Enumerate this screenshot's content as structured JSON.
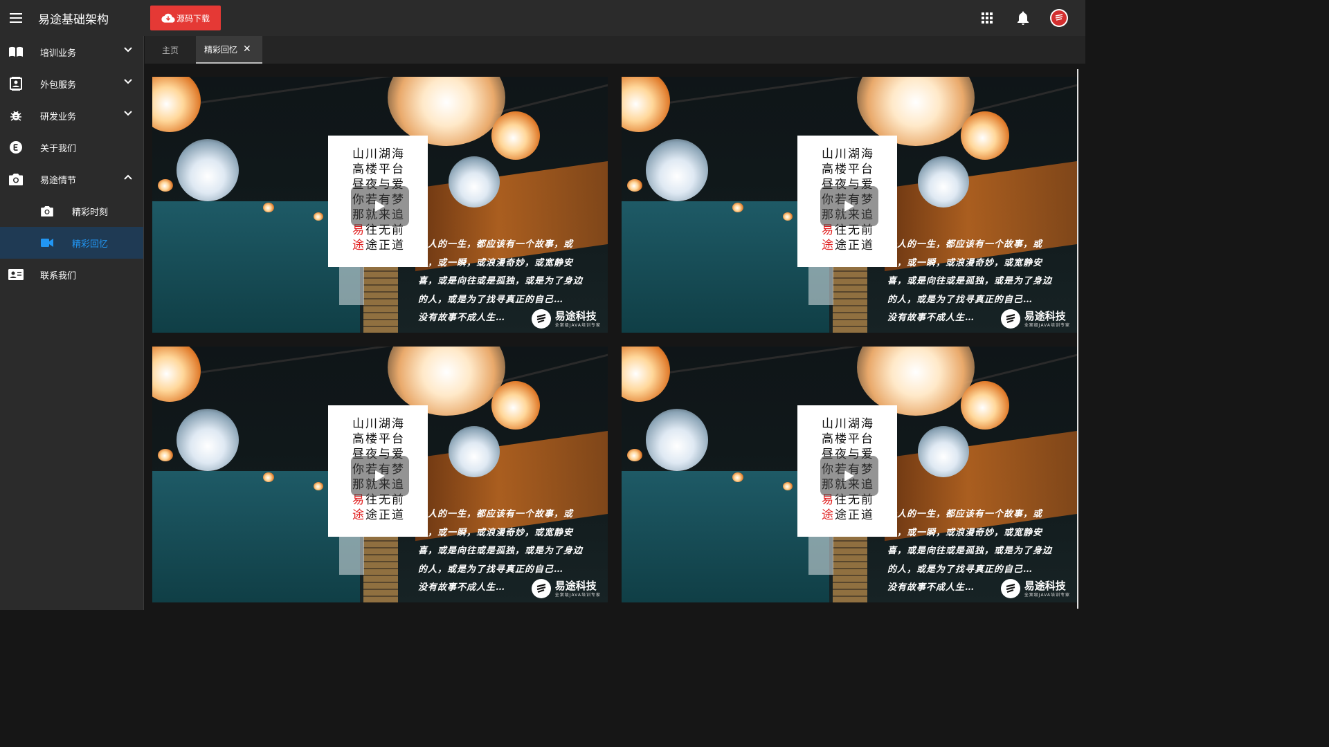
{
  "app": {
    "title": "易途基础架构",
    "download_label": "源码下载"
  },
  "top_icons": [
    "apps-grid-icon",
    "bell-icon",
    "avatar-logo"
  ],
  "sidebar": {
    "items": [
      {
        "label": "培训业务",
        "icon": "book-open-icon",
        "expandable": true,
        "expanded": false
      },
      {
        "label": "外包服务",
        "icon": "contacts-icon",
        "expandable": true,
        "expanded": false
      },
      {
        "label": "研发业务",
        "icon": "bug-icon",
        "expandable": true,
        "expanded": false
      },
      {
        "label": "关于我们",
        "icon": "e-circle-icon",
        "expandable": false
      },
      {
        "label": "易途情节",
        "icon": "camera-icon",
        "expandable": true,
        "expanded": true
      },
      {
        "label": "精彩时刻",
        "icon": "camera-icon",
        "sub": true
      },
      {
        "label": "精彩回忆",
        "icon": "videocam-icon",
        "sub": true,
        "active": true
      },
      {
        "label": "联系我们",
        "icon": "contact-card-icon",
        "expandable": false
      }
    ]
  },
  "tabs": [
    {
      "label": "主页",
      "active": false
    },
    {
      "label": "精彩回忆",
      "active": true,
      "closable": true,
      "close_label": "✕"
    }
  ],
  "video_card": {
    "poster_lines": [
      "山川湖海",
      "高楼平台",
      "昼夜与爱",
      "你若有梦",
      "那就来追"
    ],
    "poster_red_lines": [
      {
        "red": "易",
        "rest": "往无前"
      },
      {
        "red": "途",
        "rest": "途正道"
      }
    ],
    "poem_lines": [
      "个人的一生，都应该有一个故事，或",
      "长，或一瞬，或浪漫奇妙，或宽静安",
      "喜，或是向往或是孤独，或是为了身边",
      "的人，或是为了找寻真正的自己…",
      "没有故事不成人生…"
    ],
    "brand_name": "易途科技",
    "brand_tagline": "全案级JAVA培训专家"
  },
  "videos": [
    {
      "id": "1"
    },
    {
      "id": "2"
    },
    {
      "id": "3"
    },
    {
      "id": "4"
    }
  ],
  "colors": {
    "accent": "#2196f3",
    "download": "#e53935",
    "sidebar_bg": "#2b2b2b",
    "active_bg": "#1f3a54"
  }
}
